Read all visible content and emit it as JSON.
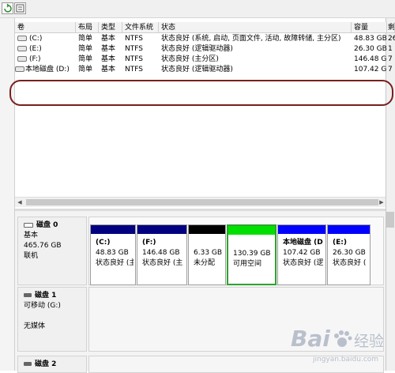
{
  "columns": [
    {
      "label": "卷"
    },
    {
      "label": "布局"
    },
    {
      "label": "类型"
    },
    {
      "label": "文件系统"
    },
    {
      "label": "状态"
    },
    {
      "label": "容量"
    },
    {
      "label": "剩"
    }
  ],
  "volumes": [
    {
      "name": "(C:)",
      "layout": "简单",
      "type": "基本",
      "fs": "NTFS",
      "status": "状态良好 (系统, 启动, 页面文件, 活动, 故障转储, 主分区)",
      "capacity": "48.83 GB",
      "free": "26"
    },
    {
      "name": "(E:)",
      "layout": "简单",
      "type": "基本",
      "fs": "NTFS",
      "status": "状态良好 (逻辑驱动器)",
      "capacity": "26.30 GB",
      "free": "1"
    },
    {
      "name": "(F:)",
      "layout": "简单",
      "type": "基本",
      "fs": "NTFS",
      "status": "状态良好 (主分区)",
      "capacity": "146.48 GB",
      "free": "7"
    },
    {
      "name": "本地磁盘 (D:)",
      "layout": "简单",
      "type": "基本",
      "fs": "NTFS",
      "status": "状态良好 (逻辑驱动器)",
      "capacity": "107.42 GB",
      "free": "7"
    }
  ],
  "disks": [
    {
      "title": "磁盘 0",
      "kind": "基本",
      "size": "465.76 GB",
      "state": "联机",
      "partitions": [
        {
          "name": "(C:)",
          "size": "48.83 GB",
          "status": "状态良好 (主",
          "bar_color": "#000080"
        },
        {
          "name": "(F:)",
          "size": "146.48 GB",
          "status": "状态良好 (主",
          "bar_color": "#000080"
        },
        {
          "name": "",
          "size": "6.33 GB",
          "status": "未分配",
          "bar_color": "#000000"
        },
        {
          "name": "",
          "size": "130.39 GB",
          "status": "可用空间",
          "bar_color": "#00e000"
        },
        {
          "name": "本地磁盘 (D",
          "size": "107.42 GB",
          "status": "状态良好 (逻",
          "bar_color": "#0000ff"
        },
        {
          "name": "(E:)",
          "size": "26.30 GB",
          "status": "状态良好 (",
          "bar_color": "#0000ff"
        }
      ]
    },
    {
      "title": "磁盘 1",
      "kind": "可移动 (G:)",
      "state": "无媒体"
    },
    {
      "title": "磁盘 2"
    }
  ],
  "watermark": {
    "brand": "Bai",
    "brand2": "经验",
    "url": "jingyan.baidu.com"
  }
}
